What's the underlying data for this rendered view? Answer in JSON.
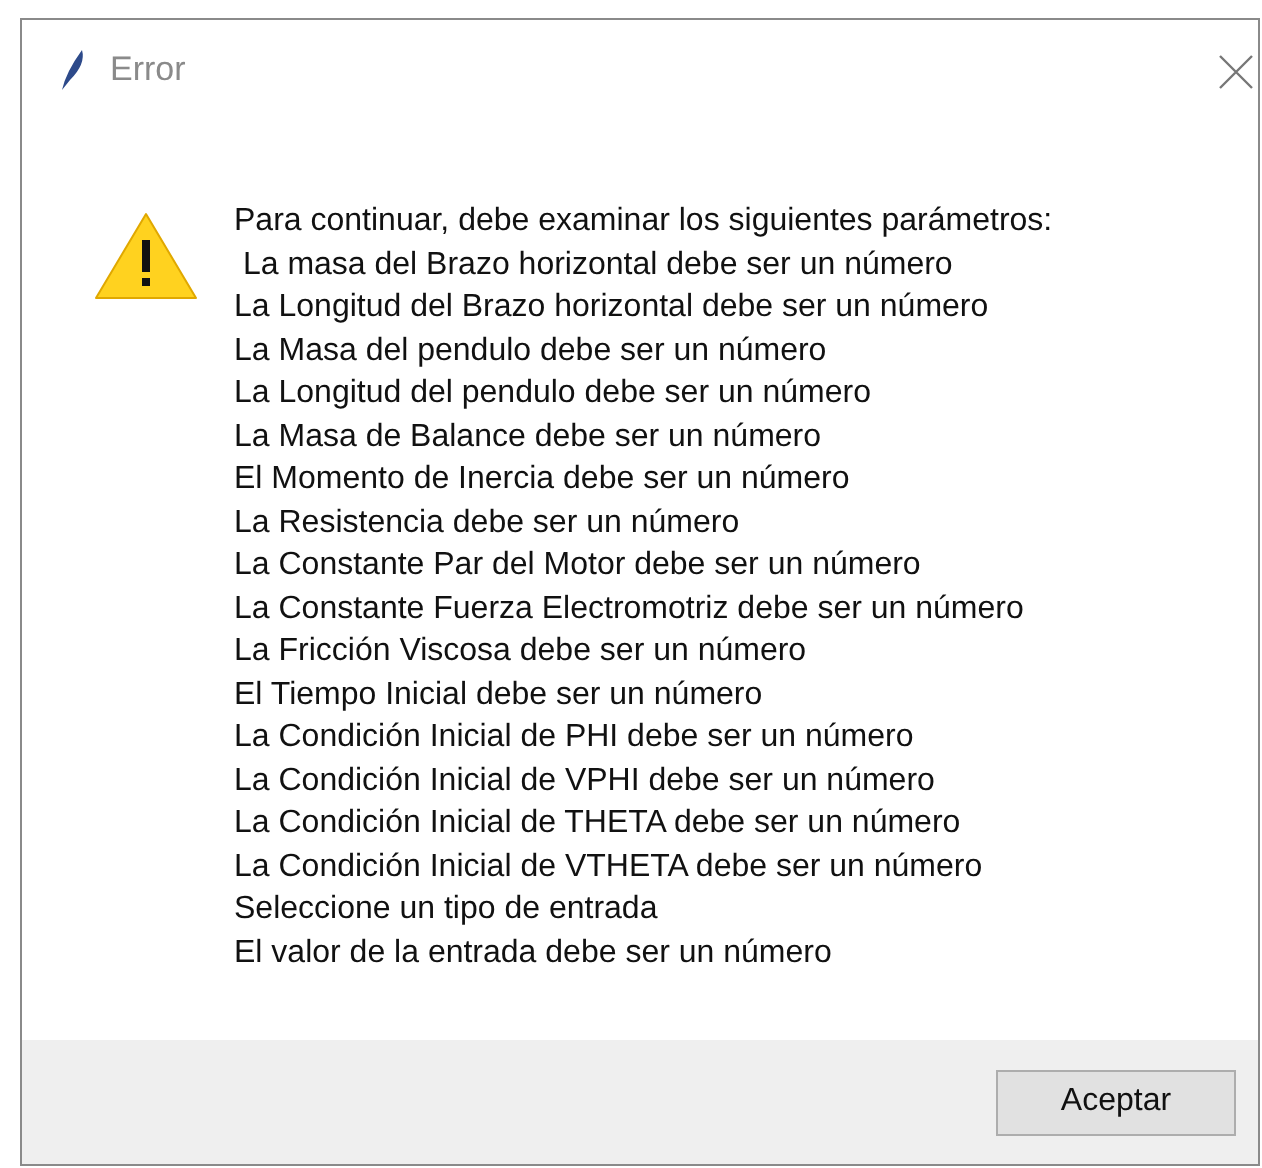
{
  "window": {
    "title": "Error"
  },
  "message": {
    "lines": [
      "Para continuar, debe examinar los siguientes parámetros:",
      " La masa del Brazo horizontal debe ser un número",
      "La Longitud del Brazo horizontal debe ser un número",
      "La Masa del pendulo debe ser un número",
      "La Longitud del pendulo debe ser un número",
      "La Masa de Balance debe ser un número",
      "El Momento de Inercia debe ser un número",
      "La Resistencia debe ser un número",
      "La Constante Par del Motor debe ser un número",
      "La Constante Fuerza Electromotriz debe ser un número",
      "La Fricción Viscosa debe ser un número",
      "El Tiempo Inicial debe ser un número",
      "La Condición Inicial de PHI debe ser un número",
      "La Condición Inicial de VPHI debe ser un número",
      "La Condición Inicial de THETA debe ser un número",
      "La Condición Inicial de VTHETA debe ser un número",
      "Seleccione un tipo de entrada",
      "El valor de la entrada debe ser un número"
    ]
  },
  "buttons": [
    "Aceptar"
  ]
}
